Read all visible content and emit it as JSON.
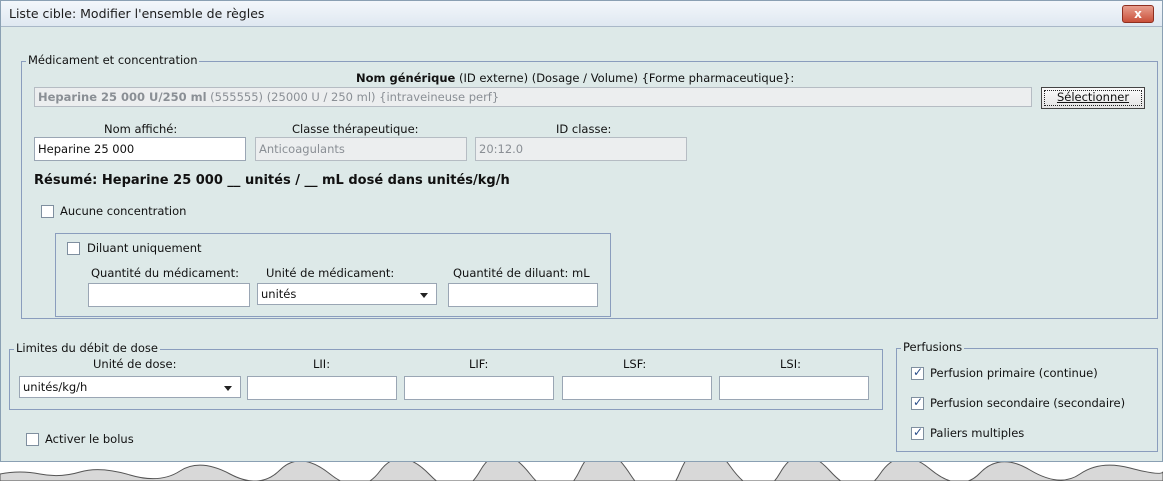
{
  "window": {
    "title": "Liste cible: Modifier l'ensemble de règles",
    "close_label": "x"
  },
  "med": {
    "legend": "Médicament et concentration",
    "header_bold": "Nom générique",
    "header_rest": "(ID externe) (Dosage / Volume) {Forme pharmaceutique}:",
    "generic_bold": "Heparine 25 000 U/250 ml",
    "generic_rest": "(555555) (25000 U / 250 ml) {intraveineuse perf}",
    "select_label": "Sélectionner",
    "display_name_label": "Nom affiché:",
    "display_name_value": "Heparine 25 000",
    "class_label": "Classe thérapeutique:",
    "class_value": "Anticoagulants",
    "class_id_label": "ID classe:",
    "class_id_value": "20:12.0",
    "summary": "Résumé: Heparine 25 000 __ unités / __ mL dosé dans unités/kg/h",
    "no_conc_label": "Aucune concentration",
    "no_conc_checked": false,
    "diluent_only_label": "Diluant uniquement",
    "diluent_only_checked": false,
    "drug_qty_label": "Quantité du médicament:",
    "drug_qty_value": "",
    "drug_unit_label": "Unité de médicament:",
    "drug_unit_value": "unités",
    "diluent_qty_label": "Quantité de diluant: mL",
    "diluent_qty_value": ""
  },
  "limits": {
    "legend": "Limites du débit de dose",
    "dose_unit_label": "Unité de dose:",
    "dose_unit_value": "unités/kg/h",
    "lii_label": "LII:",
    "lif_label": "LIF:",
    "lsf_label": "LSF:",
    "lsi_label": "LSI:",
    "lii_value": "",
    "lif_value": "",
    "lsf_value": "",
    "lsi_value": ""
  },
  "perfusions": {
    "legend": "Perfusions",
    "items": [
      {
        "label": "Perfusion primaire (continue)",
        "checked": true
      },
      {
        "label": "Perfusion secondaire (secondaire)",
        "checked": true
      },
      {
        "label": "Paliers multiples",
        "checked": true
      }
    ]
  },
  "bolus": {
    "label": "Activer le bolus",
    "checked": false
  },
  "colors": {
    "window_bg": "#dde9e8",
    "group_border": "#8a9dbd",
    "close_red": "#c9503a"
  }
}
